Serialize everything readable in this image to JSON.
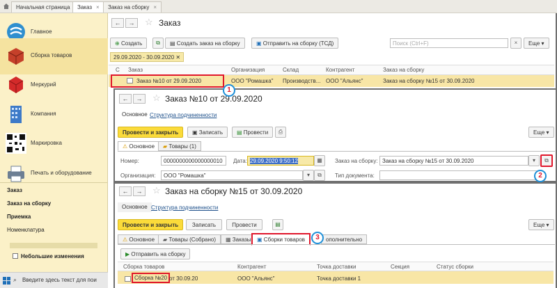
{
  "top_tabs": [
    {
      "label": "Начальная страница"
    },
    {
      "label": "Заказ"
    },
    {
      "label": "Заказ на сборку"
    }
  ],
  "sidebar": {
    "items": [
      {
        "label": "Главное"
      },
      {
        "label": "Сборка товаров"
      },
      {
        "label": "Меркурий"
      },
      {
        "label": "Компания"
      },
      {
        "label": "Маркировка"
      },
      {
        "label": "Печать и оборудование"
      }
    ],
    "links": [
      {
        "label": "Заказ"
      },
      {
        "label": "Заказ на сборку"
      },
      {
        "label": "Приемка"
      },
      {
        "label": "Номенклатура"
      }
    ],
    "checkbox_label": "Небольшие изменения",
    "taskbar_search": "Введите здесь текст для пои"
  },
  "win1": {
    "title": "Заказ",
    "btn_create": "Создать",
    "btn_create_assembly": "Создать заказ на сборку",
    "btn_send": "Отправить на сборку (ТСД)",
    "search_placeholder": "Поиск (Ctrl+F)",
    "more": "Еще",
    "filter": "29.09.2020 - 30.09.2020",
    "columns": [
      "С",
      "Заказ",
      "Организация",
      "Склад",
      "Контрагент",
      "Заказ на сборку"
    ],
    "row": {
      "order": "Заказ №10 от 29.09.2020",
      "org": "ООО \"Ромашка\"",
      "warehouse": "Производств...",
      "contractor": "ООО \"Альянс\"",
      "assembly": "Заказ на сборку №15 от 30.09.2020"
    }
  },
  "win2": {
    "title": "Заказ №10 от 29.09.2020",
    "tab_main": "Основное",
    "tab_structure": "Структура подчиненности",
    "btn_post_close": "Провести и закрыть",
    "btn_save": "Записать",
    "btn_post": "Провести",
    "more": "Еще",
    "subtab_main": "Основное",
    "subtab_goods": "Товары (1)",
    "lbl_number": "Номер:",
    "val_number": "0000000000000000010",
    "lbl_date": "Дата:",
    "val_date": "29.09.2020  9:50:12",
    "lbl_assembly": "Заказ на сборку:",
    "val_assembly": "Заказ на сборку №15 от 30.09.2020",
    "lbl_org": "Организация:",
    "val_org": "ООО \"Ромашка\"",
    "lbl_doctype": "Тип документа:"
  },
  "win3": {
    "title": "Заказ на сборку №15 от 30.09.2020",
    "tab_main": "Основное",
    "tab_structure": "Структура подчиненности",
    "btn_post_close": "Провести и закрыть",
    "btn_save": "Записать",
    "btn_post": "Провести",
    "more": "Еще",
    "subtabs": [
      "Основное",
      "Товары (Собрано)",
      "Заказы",
      "Сборки товаров",
      "ополнительно"
    ],
    "btn_send": "Отправить на сборку",
    "columns": [
      "Сборка товаров",
      "Контрагент",
      "Точка доставки",
      "Секция",
      "Статус сборки"
    ],
    "row": {
      "assembly_link": "Сборка №20",
      "assembly_date": "от 30.09.20",
      "contractor": "ООО \"Альянс\"",
      "delivery": "Точка  доставки 1"
    }
  },
  "markers": [
    "1",
    "2",
    "3"
  ]
}
